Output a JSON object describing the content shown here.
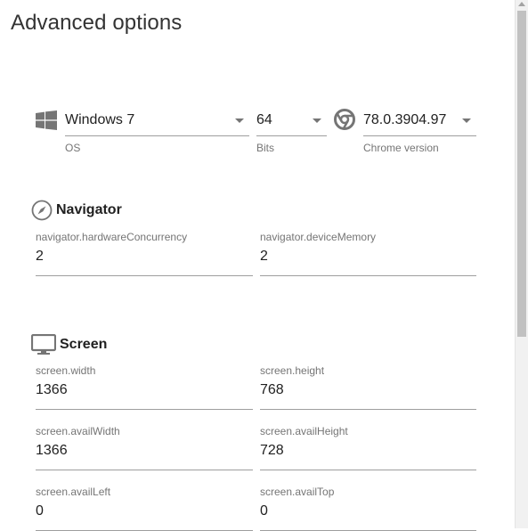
{
  "title": "Advanced options",
  "platform": {
    "os": {
      "value": "Windows 7",
      "helper": "OS",
      "icon": "windows-icon"
    },
    "bits": {
      "value": "64",
      "helper": "Bits"
    },
    "chrome": {
      "value": "78.0.3904.97",
      "helper": "Chrome version",
      "icon": "chrome-icon"
    }
  },
  "navigator": {
    "heading": "Navigator",
    "icon": "compass-icon",
    "fields": [
      {
        "label": "navigator.hardwareConcurrency",
        "value": "2"
      },
      {
        "label": "navigator.deviceMemory",
        "value": "2"
      }
    ]
  },
  "screen": {
    "heading": "Screen",
    "icon": "monitor-icon",
    "fields": [
      {
        "label": "screen.width",
        "value": "1366"
      },
      {
        "label": "screen.height",
        "value": "768"
      },
      {
        "label": "screen.availWidth",
        "value": "1366"
      },
      {
        "label": "screen.availHeight",
        "value": "728"
      },
      {
        "label": "screen.availLeft",
        "value": "0"
      },
      {
        "label": "screen.availTop",
        "value": "0"
      }
    ]
  }
}
